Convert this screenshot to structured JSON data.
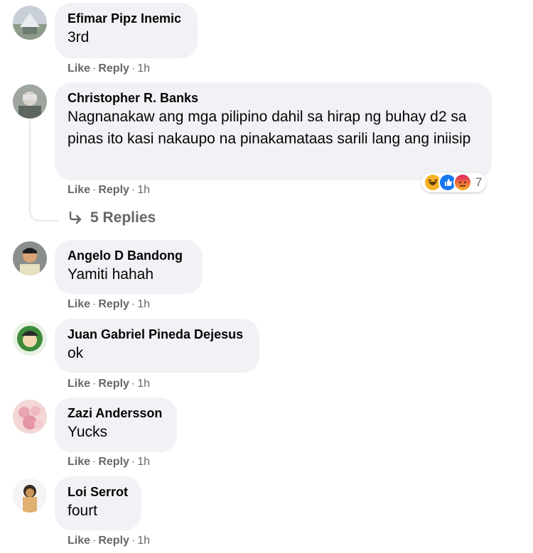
{
  "comments": [
    {
      "author": "Efimar Pipz Inemic",
      "text": "3rd",
      "like": "Like",
      "reply": "Reply",
      "time": "1h"
    },
    {
      "author": "Christopher R. Banks",
      "text": "Nagnanakaw ang mga pilipino dahil sa hirap ng buhay d2 sa pinas ito kasi nakaupo na pinakamataas sarili lang ang iniisip",
      "like": "Like",
      "reply": "Reply",
      "time": "1h",
      "reaction_count": "7",
      "reaction_icons": [
        "haha-icon",
        "like-icon",
        "angry-icon"
      ],
      "replies_label": "5 Replies"
    },
    {
      "author": "Angelo D Bandong",
      "text": "Yamiti hahah",
      "like": "Like",
      "reply": "Reply",
      "time": "1h"
    },
    {
      "author": "Juan Gabriel Pineda Dejesus",
      "text": "ok",
      "like": "Like",
      "reply": "Reply",
      "time": "1h"
    },
    {
      "author": "Zazi Andersson",
      "text": "Yucks",
      "like": "Like",
      "reply": "Reply",
      "time": "1h"
    },
    {
      "author": "Loi Serrot",
      "text": "fourt",
      "like": "Like",
      "reply": "Reply",
      "time": "1h"
    }
  ],
  "colors": {
    "bubble": "#f0f2f5",
    "secondary_text": "#65676b",
    "like_blue": "#1877f2",
    "haha_yellow": "#f7b125",
    "angry_orange": "#e9710f"
  }
}
